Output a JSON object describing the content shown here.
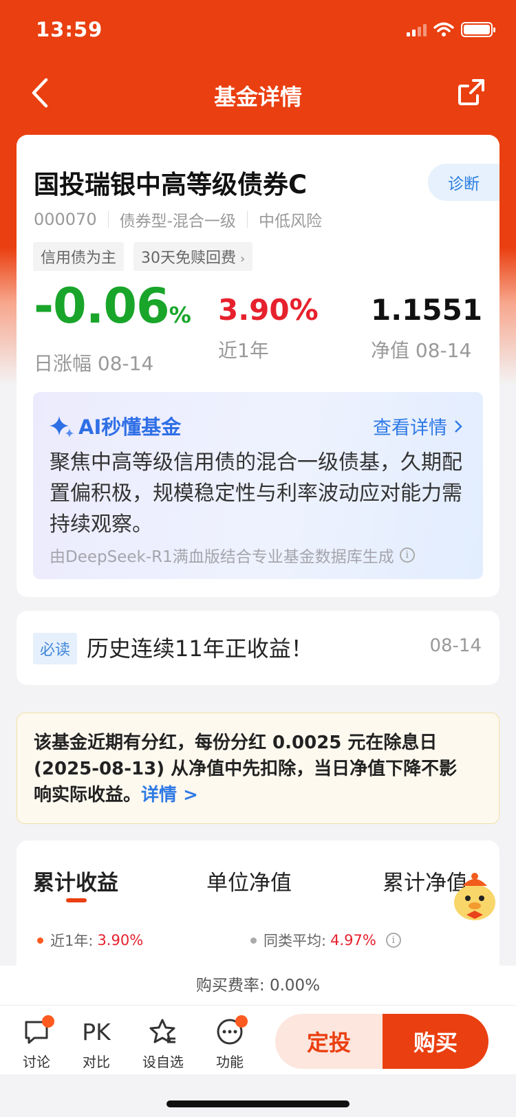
{
  "status_bar": {
    "time": "13:59"
  },
  "nav": {
    "title": "基金详情",
    "back_icon": "chevron-left-icon",
    "share_icon": "share-icon"
  },
  "fund": {
    "name": "国投瑞银中高等级债券C",
    "diagnose_label": "诊断",
    "code": "000070",
    "type": "债券型-混合一级",
    "risk": "中低风险",
    "tags": [
      "信用债为主",
      "30天免赎回费"
    ],
    "daily_change": {
      "value": "-0.06",
      "unit": "%",
      "label": "日涨幅 08-14",
      "color": "#19a52a"
    },
    "one_year": {
      "value": "3.90%",
      "label": "近1年",
      "color": "#e6212d"
    },
    "nav_value": {
      "value": "1.1551",
      "label": "净值 08-14"
    }
  },
  "ai": {
    "title": "AI秒懂基金",
    "more_label": "查看详情",
    "summary": "聚焦中高等级信用债的混合一级债基，久期配置偏积极，规模稳定性与利率波动应对能力需持续观察。",
    "footer": "由DeepSeek-R1满血版结合专业基金数据库生成"
  },
  "must_read": {
    "tag": "必读",
    "title": "历史连续11年正收益！",
    "date": "08-14"
  },
  "notice": {
    "text": "该基金近期有分红，每份分红 0.0025 元在除息日 (2025-08-13) 从净值中先扣除，当日净值下降不影响实际收益。",
    "link": "详情 >"
  },
  "chart_tabs": {
    "tabs": [
      "累计收益",
      "单位净值",
      "累计净值"
    ],
    "active": 0,
    "legend": [
      {
        "label": "近1年:",
        "value": "3.90%",
        "color": "#ff5a1f"
      },
      {
        "label": "同类平均:",
        "value": "4.97%",
        "color": "#aaaaaa"
      }
    ]
  },
  "fee": {
    "text": "购买费率: 0.00%"
  },
  "bottom_bar": {
    "items": [
      {
        "label": "讨论",
        "icon": "chat-bubble-icon",
        "badge": true
      },
      {
        "label": "对比",
        "icon": "pk-icon",
        "text": "PK",
        "badge": false
      },
      {
        "label": "设自选",
        "icon": "star-add-icon",
        "badge": false
      },
      {
        "label": "功能",
        "icon": "more-dots-icon",
        "badge": true
      }
    ],
    "sip_label": "定投",
    "buy_label": "购买"
  },
  "colors": {
    "brand": "#ea3f10",
    "up": "#e6212d",
    "down": "#19a52a",
    "link": "#2f7ae5"
  }
}
